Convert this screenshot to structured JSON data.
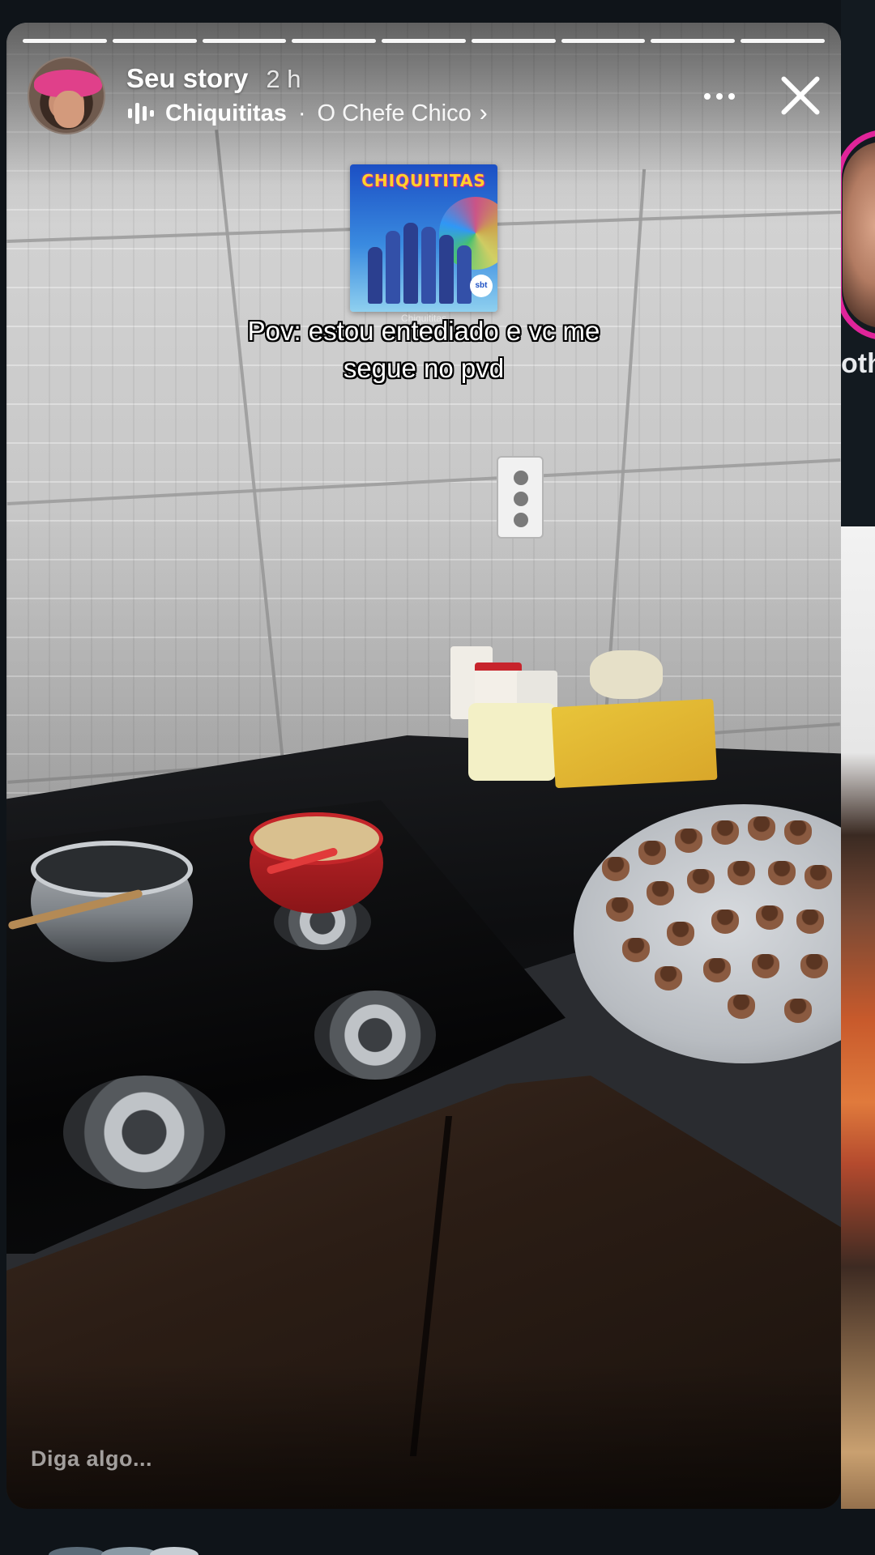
{
  "story": {
    "username": "Seu story",
    "time_ago": "2 h",
    "music": {
      "song": "Chiquititas",
      "separator": "·",
      "artist": "O Chefe Chico",
      "chevron": "›"
    },
    "progress": {
      "segments": 9,
      "completed": 9
    },
    "album_sticker": {
      "title": "CHIQUITITAS",
      "badge": "sbt",
      "caption": "Chiquititas"
    },
    "caption_line1": "Pov: estou entediado e vc me",
    "caption_line2": "segue no pvd",
    "reply_placeholder": "Diga algo...",
    "icons": {
      "more": "more-horizontal-icon",
      "close": "close-icon",
      "music": "music-bars-icon"
    }
  },
  "next_story_peek": {
    "name_fragment": "othe"
  },
  "colors": {
    "background": "#0f1419",
    "story_ring_start": "#e0249a",
    "story_ring_end": "#ff6a00"
  }
}
